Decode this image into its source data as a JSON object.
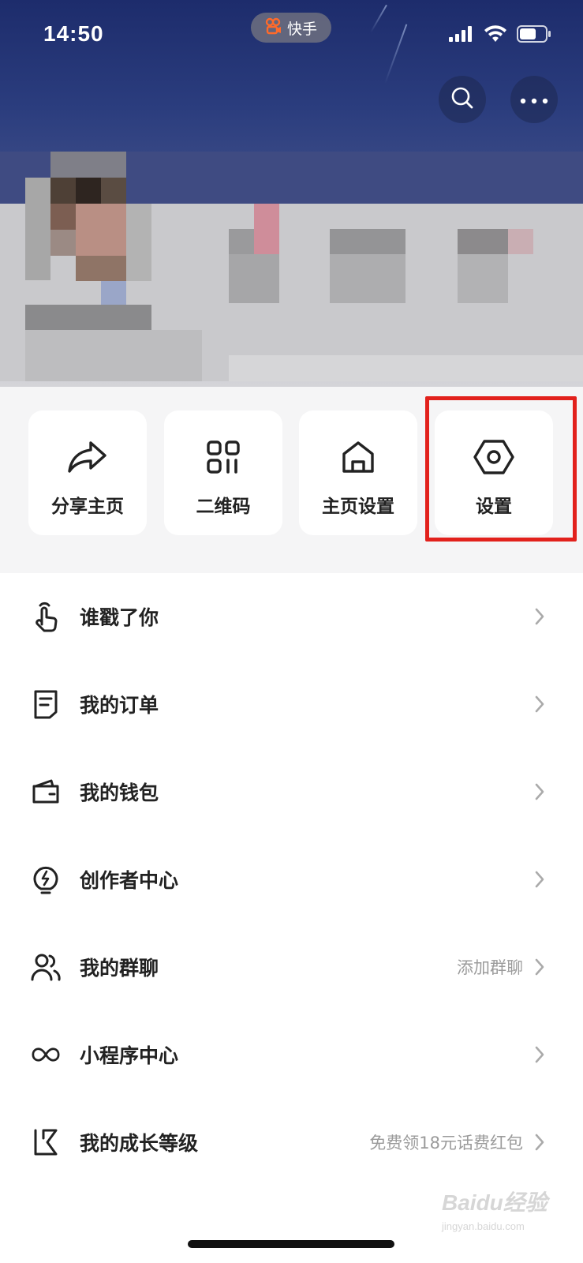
{
  "status_bar": {
    "time": "14:50",
    "app_name": "快手",
    "icons": [
      "signal-icon",
      "wifi-icon",
      "battery-icon"
    ]
  },
  "header": {
    "buttons": [
      {
        "name": "search-button",
        "icon": "search-icon"
      },
      {
        "name": "more-button",
        "icon": "more-dots-icon"
      }
    ],
    "profile_blurred": true
  },
  "actions": [
    {
      "label": "分享主页",
      "icon": "share-icon"
    },
    {
      "label": "二维码",
      "icon": "qr-code-icon"
    },
    {
      "label": "主页设置",
      "icon": "home-icon"
    },
    {
      "label": "设置",
      "icon": "hex-gear-icon",
      "highlighted": true
    }
  ],
  "menu": [
    {
      "label": "谁戳了你",
      "icon": "tap-hand-icon",
      "hint": ""
    },
    {
      "label": "我的订单",
      "icon": "order-icon",
      "hint": ""
    },
    {
      "label": "我的钱包",
      "icon": "wallet-icon",
      "hint": ""
    },
    {
      "label": "创作者中心",
      "icon": "bulb-icon",
      "hint": ""
    },
    {
      "label": "我的群聊",
      "icon": "group-icon",
      "hint": "添加群聊"
    },
    {
      "label": "小程序中心",
      "icon": "infinity-icon",
      "hint": ""
    },
    {
      "label": "我的成长等级",
      "icon": "growth-k-icon",
      "hint": "免费领18元话费红包"
    }
  ],
  "watermark": {
    "brand": "Baidu经验",
    "url": "jingyan.baidu.com"
  },
  "colors": {
    "highlight": "#e2211c",
    "header_top": "#1d2c6c",
    "card_bg": "#ffffff",
    "section_bg": "#f5f5f6"
  }
}
